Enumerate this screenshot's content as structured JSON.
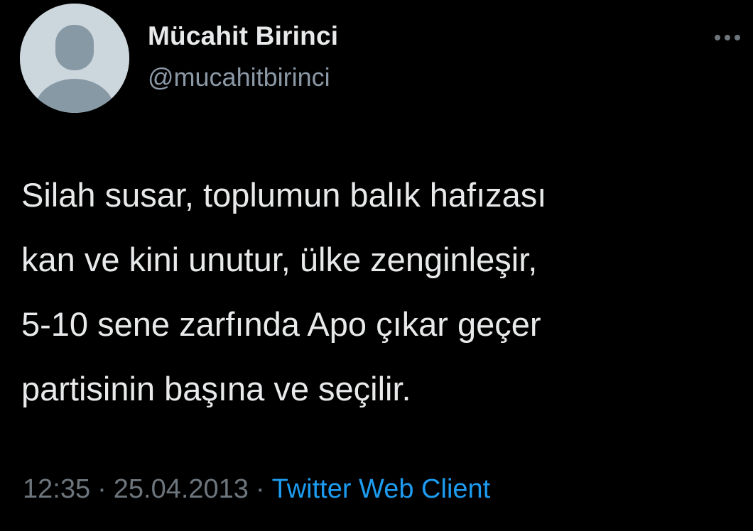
{
  "user": {
    "display_name": "Mücahit Birinci",
    "handle": "@mucahitbirinci",
    "avatar_icon": "default-profile-icon"
  },
  "menu": {
    "icon": "more-horizontal-icon"
  },
  "tweet": {
    "lines": [
      "Silah susar, toplumun balık hafızası",
      "kan ve kini unutur, ülke zenginleşir,",
      "5-10 sene zarfında Apo çıkar geçer",
      "partisinin başına ve seçilir."
    ]
  },
  "meta": {
    "time": "12:35",
    "separator": "·",
    "date": "25.04.2013",
    "source": "Twitter Web Client"
  },
  "colors": {
    "background": "#000000",
    "text_primary": "#e7e9ea",
    "text_secondary": "#6e767d",
    "link": "#1d9bf0",
    "avatar_bg": "#ccd6dd",
    "avatar_figure": "#8899a6"
  }
}
